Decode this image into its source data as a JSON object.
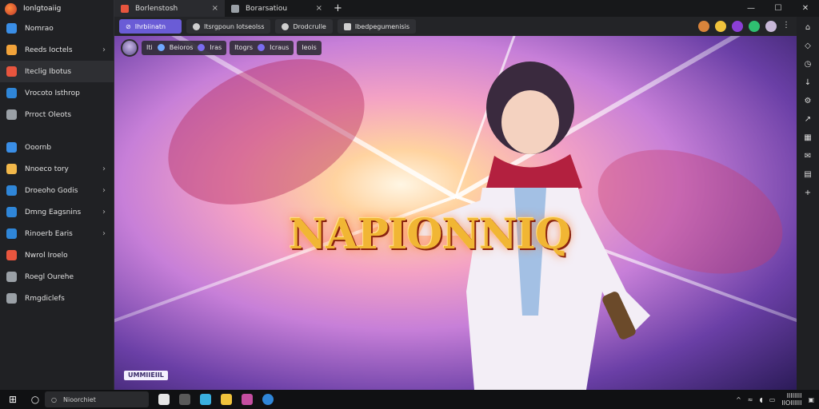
{
  "app": {
    "title": "Ionlgtoaiig"
  },
  "tabs": [
    {
      "label": "Borlenstosh",
      "close": "×"
    },
    {
      "label": "Borarsatiou",
      "close": "×"
    }
  ],
  "new_tab": "+",
  "window_controls": {
    "minimize": "—",
    "maximize": "☐",
    "close": "✕"
  },
  "sidebar": {
    "items": [
      {
        "label": "Nomrao",
        "color": "#3a8ee6",
        "chevron": false
      },
      {
        "label": "Reeds Ioctels",
        "color": "#f2a33a",
        "chevron": true
      },
      {
        "label": "Iteclig Ibotus",
        "color": "#e8553e",
        "chevron": false,
        "active": true
      },
      {
        "label": "Vrocoto Isthrop",
        "color": "#2f86d8",
        "chevron": false
      },
      {
        "label": "Prroct Oleots",
        "color": "#9aa0a6",
        "chevron": false
      },
      {
        "label": "Ooornb",
        "color": "#3a8ee6",
        "chevron": false
      },
      {
        "label": "Nnoeco tory",
        "color": "#f2b84a",
        "chevron": true
      },
      {
        "label": "Droeoho Godis",
        "color": "#2f86d8",
        "chevron": true
      },
      {
        "label": "Dmng Eagsnins",
        "color": "#2f86d8",
        "chevron": true
      },
      {
        "label": "Rinoerb Earis",
        "color": "#2f86d8",
        "chevron": true
      },
      {
        "label": "Nwrol Iroelo",
        "color": "#e8553e",
        "chevron": false
      },
      {
        "label": "Roegl Ourehe",
        "color": "#9aa0a6",
        "chevron": false
      },
      {
        "label": "Rmgdiclefs",
        "color": "#9aa0a6",
        "chevron": false
      }
    ]
  },
  "toolbar": {
    "buttons": [
      "Ihrbiinatn",
      "Itsrgpoun Iotseolss",
      "Drodcrulle",
      "Ibedpegumenisis"
    ]
  },
  "bookmarks": {
    "groups": [
      "Iti",
      "Beioros",
      "Iras",
      "Itogrs",
      "Icraus",
      "Ieois"
    ]
  },
  "artwork": {
    "title": "NAPIONNIQ",
    "tag": "UMMIIEIIL"
  },
  "taskbar": {
    "search_placeholder": "Nioorchiet",
    "clock_time": "IIIIIIII",
    "clock_date": "IIOIIIIII"
  }
}
